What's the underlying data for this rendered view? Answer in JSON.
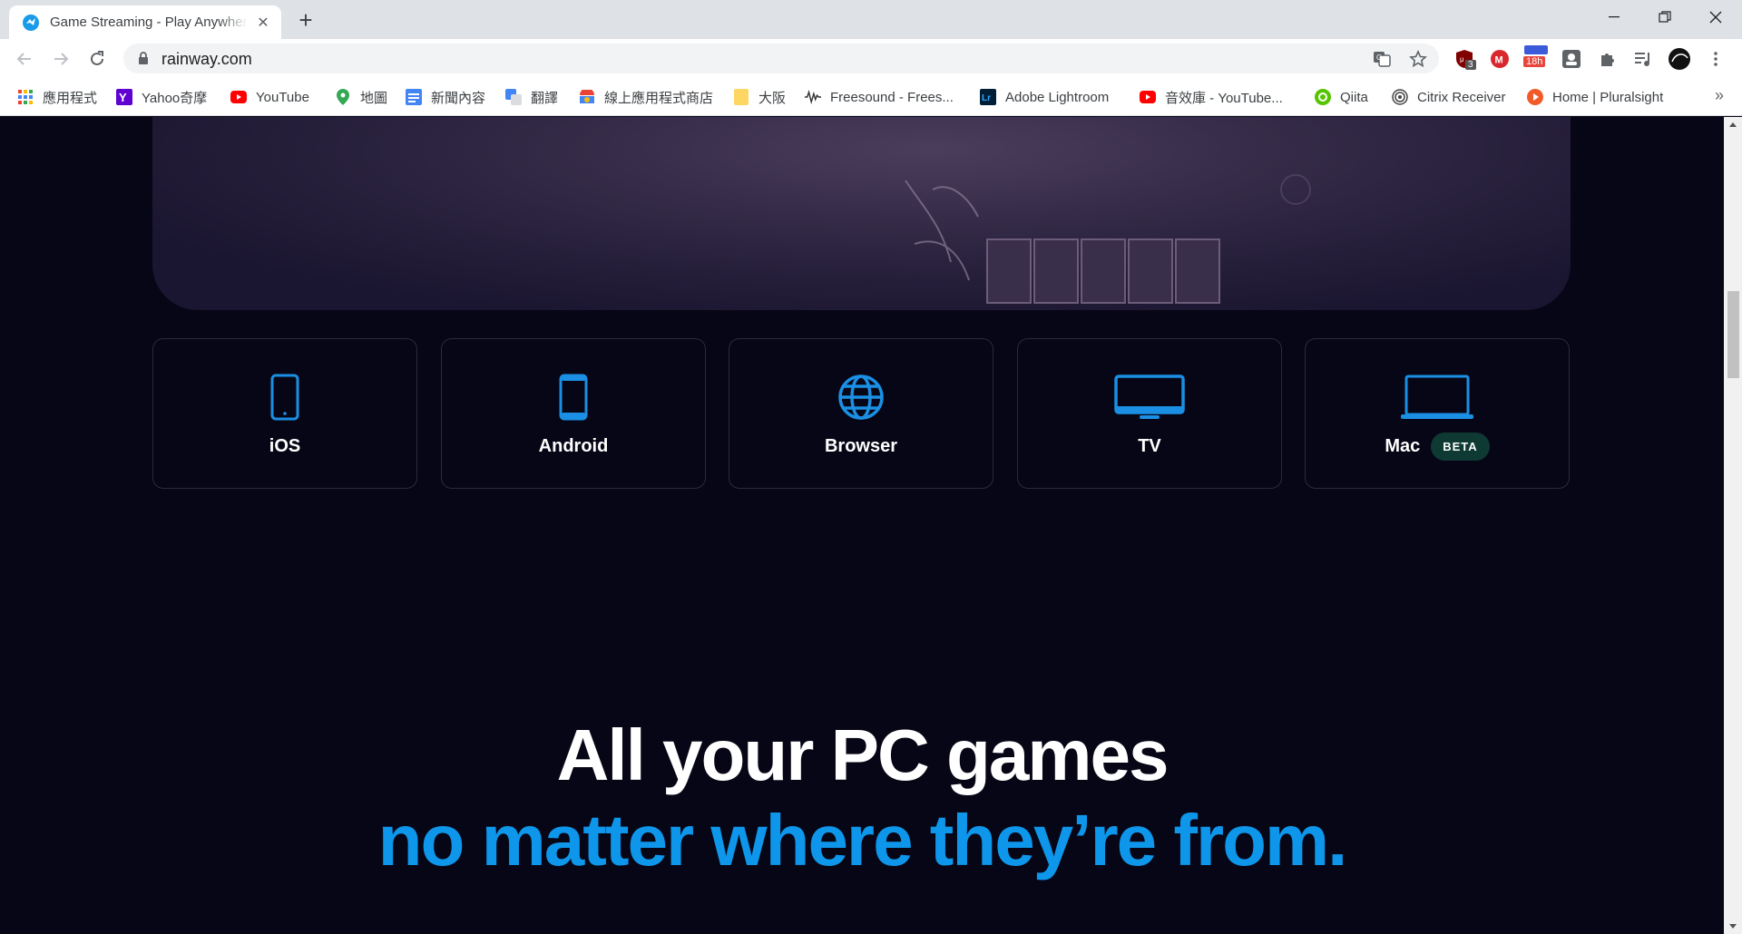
{
  "browser": {
    "tab_title": "Game Streaming - Play Anywhere",
    "url": "rainway.com",
    "extensions": {
      "ublock_badge": "3",
      "calendar_badge": "18h"
    }
  },
  "bookmarks": [
    {
      "label": "應用程式",
      "icon": "apps-grid-icon"
    },
    {
      "label": "Yahoo奇摩",
      "icon": "yahoo-icon"
    },
    {
      "label": "YouTube",
      "icon": "youtube-icon"
    },
    {
      "label": "地圖",
      "icon": "maps-pin-icon"
    },
    {
      "label": "新聞內容",
      "icon": "google-news-icon"
    },
    {
      "label": "翻譯",
      "icon": "translate-icon"
    },
    {
      "label": "線上應用程式商店",
      "icon": "webstore-icon"
    },
    {
      "label": "大阪",
      "icon": "folder-icon"
    },
    {
      "label": "Freesound - Frees...",
      "icon": "freesound-icon"
    },
    {
      "label": "Adobe Lightroom",
      "icon": "lightroom-icon"
    },
    {
      "label": "音效庫 - YouTube...",
      "icon": "youtube-icon"
    },
    {
      "label": "Qiita",
      "icon": "qiita-icon"
    },
    {
      "label": "Citrix Receiver",
      "icon": "citrix-icon"
    },
    {
      "label": "Home | Pluralsight",
      "icon": "pluralsight-icon"
    }
  ],
  "platforms": [
    {
      "label": "iOS",
      "icon": "phone-icon"
    },
    {
      "label": "Android",
      "icon": "android-phone-icon"
    },
    {
      "label": "Browser",
      "icon": "globe-icon"
    },
    {
      "label": "TV",
      "icon": "tv-icon"
    },
    {
      "label": "Mac",
      "icon": "laptop-icon",
      "badge": "BETA"
    }
  ],
  "headline": {
    "line1": "All your PC games",
    "line2": "no matter where they’re from."
  },
  "colors": {
    "accent": "#0d96ea",
    "page_bg": "#070616",
    "icon_blue": "#1a8fe3"
  }
}
